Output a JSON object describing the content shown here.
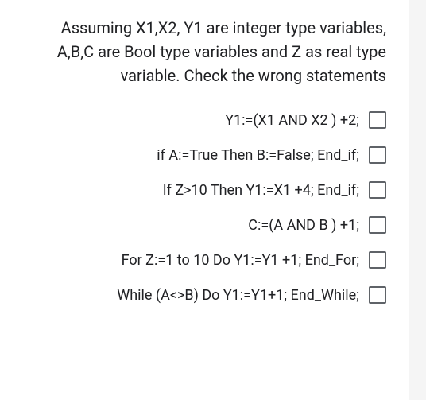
{
  "question": {
    "text": "Assuming X1,X2, Y1 are integer type variables, A,B,C are Bool type variables and Z as real type variable. Check the wrong statements"
  },
  "options": [
    {
      "label": "Y1:=(X1 AND X2 ) +2;"
    },
    {
      "label": "if A:=True Then B:=False; End_if;"
    },
    {
      "label": "If Z>10 Then Y1:=X1 +4; End_if;"
    },
    {
      "label": "C:=(A AND B ) +1;"
    },
    {
      "label": "For Z:=1 to 10 Do Y1:=Y1 +1; End_For;"
    },
    {
      "label": "While (A<>B) Do Y1:=Y1+1; End_While;"
    }
  ]
}
